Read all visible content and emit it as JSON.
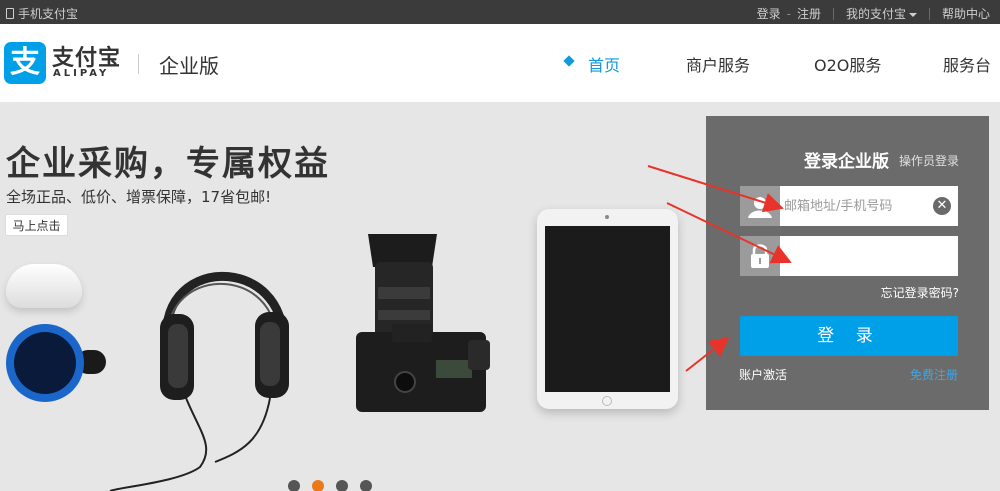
{
  "topbar": {
    "mobile": "手机支付宝",
    "login": "登录",
    "dash": "-",
    "register": "注册",
    "my_alipay": "我的支付宝",
    "help": "帮助中心"
  },
  "header": {
    "logo_glyph": "支",
    "logo_cn": "支付宝",
    "logo_en": "ALIPAY",
    "edition": "企业版",
    "nav": [
      "首页",
      "商户服务",
      "O2O服务",
      "服务台"
    ],
    "active_nav": "首页"
  },
  "banner": {
    "title": "企业采购，专属权益",
    "subtitle": "全场正品、低价、增票保障，17省包邮!",
    "cta": "马上点击",
    "carousel_count": 4,
    "carousel_active": 2
  },
  "login": {
    "title": "登录企业版",
    "subtitle": "操作员登录",
    "account_placeholder": "邮箱地址/手机号码",
    "password_value": "",
    "forgot": "忘记登录密码?",
    "submit": "登 录",
    "activate": "账户激活",
    "register": "免费注册"
  },
  "icons": {
    "account": "user-icon",
    "password": "lock-icon",
    "clear": "clear-icon"
  },
  "colors": {
    "brand_blue": "#00a0e9",
    "topbar_bg": "#3b3b3b",
    "login_panel": "#6b6b6b",
    "carousel_active": "#ea7a19",
    "annotation_arrow": "#e8332a"
  }
}
